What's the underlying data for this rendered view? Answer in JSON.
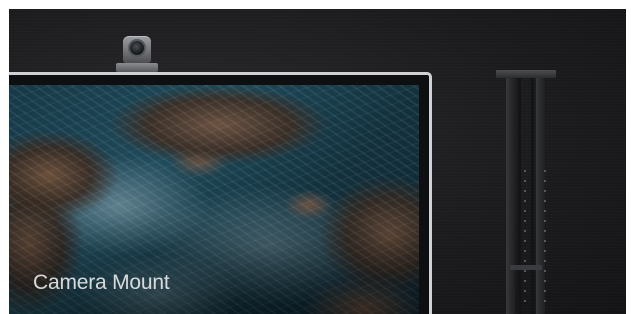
{
  "caption": {
    "text": "Camera Mount"
  },
  "scene": {
    "camera_icon": "ptz-camera-icon",
    "bracket_icon": "mounting-bracket-icon",
    "background_color": "#1c1c1f",
    "display_bezel_color": "#cfd1d4"
  }
}
